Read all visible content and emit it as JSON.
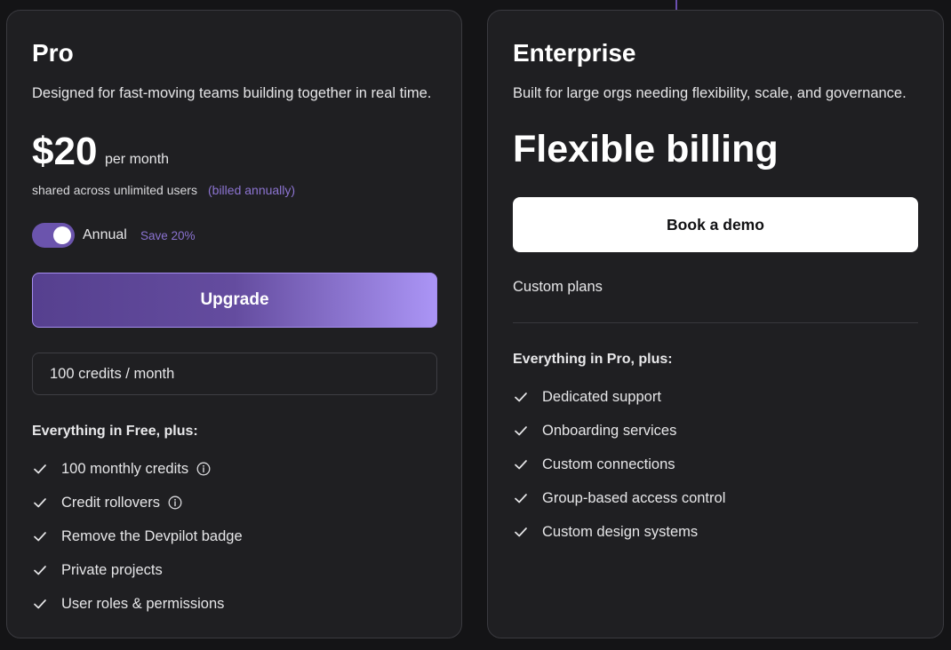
{
  "pro": {
    "title": "Pro",
    "description": "Designed for fast-moving teams building together in real time.",
    "price": "$20",
    "period": "per month",
    "shared_text": "shared across unlimited users",
    "billed_text": "(billed annually)",
    "toggle": {
      "label": "Annual",
      "badge": "Save 20%",
      "on": true
    },
    "cta_label": "Upgrade",
    "credits_option": "100 credits / month",
    "features_title": "Everything in Free, plus:",
    "features": [
      {
        "label": "100 monthly credits",
        "info": true
      },
      {
        "label": "Credit rollovers",
        "info": true
      },
      {
        "label": "Remove the Devpilot badge",
        "info": false
      },
      {
        "label": "Private projects",
        "info": false
      },
      {
        "label": "User roles & permissions",
        "info": false
      }
    ]
  },
  "enterprise": {
    "title": "Enterprise",
    "description": "Built for large orgs needing flexibility, scale, and governance.",
    "price_text": "Flexible billing",
    "cta_label": "Book a demo",
    "custom_plans": "Custom plans",
    "features_title": "Everything in Pro, plus:",
    "features": [
      {
        "label": "Dedicated support"
      },
      {
        "label": "Onboarding services"
      },
      {
        "label": "Custom connections"
      },
      {
        "label": "Group-based access control"
      },
      {
        "label": "Custom design systems"
      }
    ]
  },
  "icons": {
    "check": "check-icon",
    "info": "info-icon"
  },
  "colors": {
    "background": "#141416",
    "card": "#1f1f22",
    "accent": "#8c74d1",
    "accent_gradient_end": "#ab95f6"
  }
}
